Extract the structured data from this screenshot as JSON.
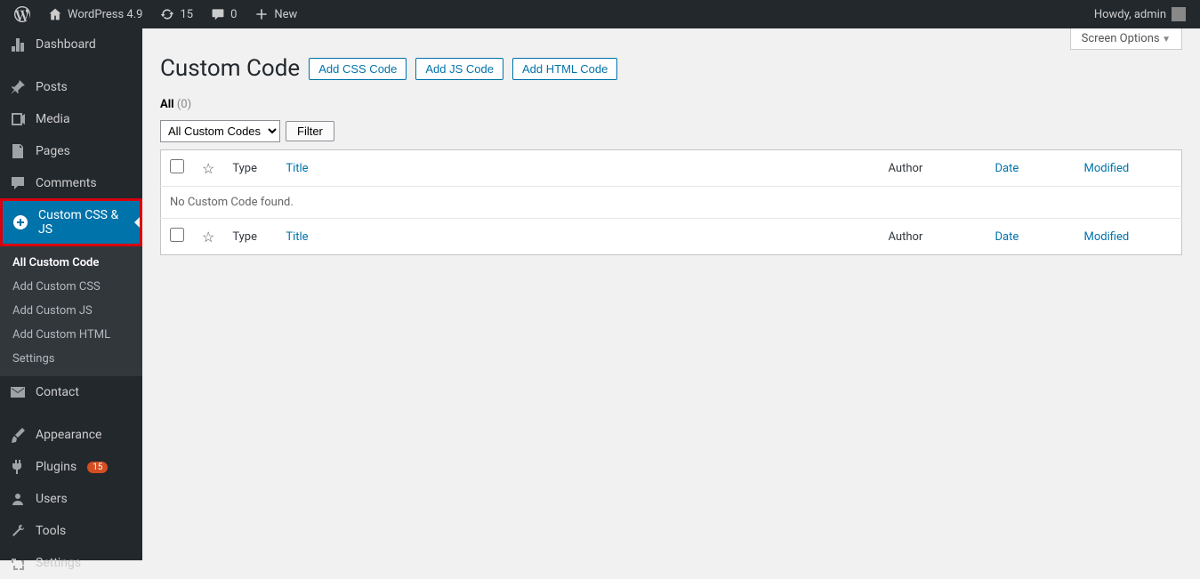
{
  "adminbar": {
    "site_name": "WordPress 4.9",
    "updates": "15",
    "comments": "0",
    "new_label": "New",
    "greeting": "Howdy, admin"
  },
  "sidebar": {
    "items": [
      {
        "label": "Dashboard",
        "icon": "dashboard"
      },
      {
        "label": "Posts",
        "icon": "pin"
      },
      {
        "label": "Media",
        "icon": "media"
      },
      {
        "label": "Pages",
        "icon": "page"
      },
      {
        "label": "Comments",
        "icon": "comment"
      },
      {
        "label": "Custom CSS & JS",
        "icon": "plus-circle",
        "current": true
      },
      {
        "label": "Contact",
        "icon": "mail"
      },
      {
        "label": "Appearance",
        "icon": "brush"
      },
      {
        "label": "Plugins",
        "icon": "plug",
        "badge": "15"
      },
      {
        "label": "Users",
        "icon": "users"
      },
      {
        "label": "Tools",
        "icon": "tools"
      },
      {
        "label": "Settings",
        "icon": "settings"
      }
    ],
    "submenu": [
      {
        "label": "All Custom Code",
        "active": true
      },
      {
        "label": "Add Custom CSS"
      },
      {
        "label": "Add Custom JS"
      },
      {
        "label": "Add Custom HTML"
      },
      {
        "label": "Settings"
      }
    ]
  },
  "content": {
    "screen_options": "Screen Options",
    "heading": "Custom Code",
    "buttons": {
      "add_css": "Add CSS Code",
      "add_js": "Add JS Code",
      "add_html": "Add HTML Code"
    },
    "subsubsub": {
      "label": "All",
      "count": "(0)"
    },
    "filter": {
      "select": "All Custom Codes",
      "button": "Filter"
    },
    "columns": {
      "type": "Type",
      "title": "Title",
      "author": "Author",
      "date": "Date",
      "modified": "Modified"
    },
    "empty_message": "No Custom Code found."
  }
}
